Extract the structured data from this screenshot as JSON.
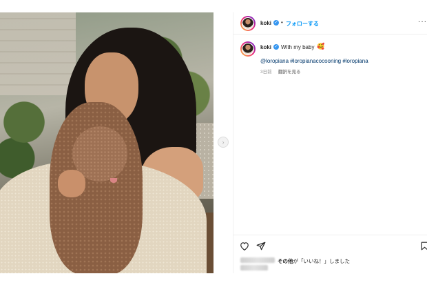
{
  "post": {
    "username": "koki",
    "follow_label": "フォローする",
    "separator": "•",
    "more_label": "···",
    "caption": "With my baby",
    "caption_emoji": "🥰",
    "hashtags": "@loropiana #loropianacocooning #loropiana",
    "time_ago": "3日前",
    "translate_label": "翻訳を見る",
    "likes_suffix": "その他",
    "likes_rest": "が「いいね！」しました"
  },
  "icons": {
    "verified": "verified-badge-icon",
    "like": "heart-icon",
    "share": "send-icon",
    "save": "bookmark-icon",
    "next": "chevron-right-icon"
  },
  "colors": {
    "accent": "#0095f6",
    "link": "#00376b",
    "muted": "#8e8e8e",
    "verified": "#3897f0"
  }
}
